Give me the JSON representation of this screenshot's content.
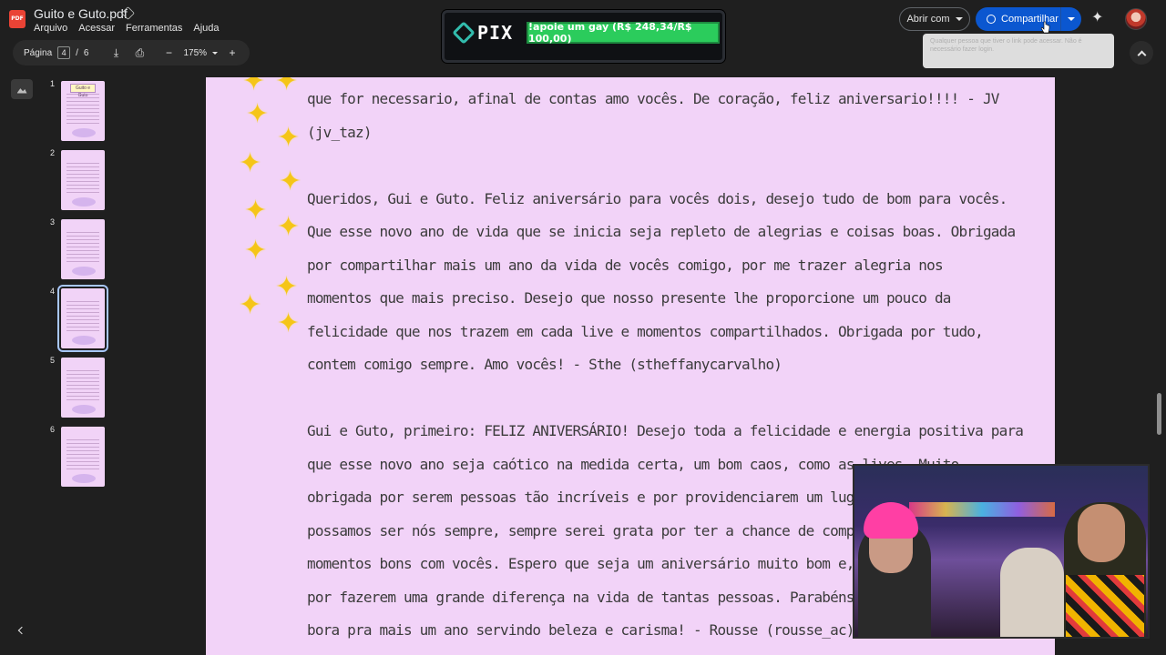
{
  "header": {
    "app_icon_label": "PDF",
    "title": "Guito e Guto.pdf",
    "menu": [
      "Arquivo",
      "Acessar",
      "Ferramentas",
      "Ajuda"
    ],
    "open_with": "Abrir com",
    "share": "Compartilhar",
    "tooltip": "Qualquer pessoa que tiver o link pode acessar. Não é necessário fazer login."
  },
  "overlay_pix": {
    "logo_text": "PIX",
    "goal_text": "!apoie um gay (R$ 248,34/R$ 100,00)"
  },
  "toolbar": {
    "page_label": "Página",
    "current_page": "4",
    "separator": "/",
    "total_pages": "6",
    "zoom": "175%"
  },
  "sidebar": {
    "pages": [
      {
        "num": "1",
        "header": "Guito e Guto"
      },
      {
        "num": "2"
      },
      {
        "num": "3"
      },
      {
        "num": "4",
        "active": true
      },
      {
        "num": "5"
      },
      {
        "num": "6"
      }
    ]
  },
  "document": {
    "paragraphs": [
      "que for necessario, afinal de contas amo vocês. De coração, feliz aniversario!!!! - JV\n(jv_taz)",
      "Queridos, Gui e Guto. Feliz aniversário para vocês dois, desejo tudo de bom para vocês.\nQue esse novo ano de vida que se inicia seja repleto de alegrias e coisas boas. Obrigada\npor compartilhar mais um ano da vida de vocês comigo, por me trazer alegria nos\nmomentos que mais preciso. Desejo que nosso presente lhe proporcione um pouco da\nfelicidade que nos trazem em cada live e momentos compartilhados. Obrigada por tudo,\ncontem comigo sempre. Amo vocês! - Sthe (stheffanycarvalho)",
      "Gui e Guto, primeiro: FELIZ ANIVERSÁRIO! Desejo toda a felicidade e energia positiva para\nque esse novo ano seja caótico na medida certa, um bom caos, como as lives. Muito\nobrigada por serem pessoas tão incríveis e por providenciarem um lugar s\npossamos ser nós sempre, sempre serei grata por ter a chance de compar\nmomentos bons com vocês. Espero que seja um aniversário muito bom e, de m\npor fazerem uma grande diferença na vida de tantas pessoas. Parabéns! A\nbora pra mais um ano servindo beleza e carisma! - Rousse (rousse_ac)"
    ]
  },
  "colors": {
    "page_bg": "#f2d3f8",
    "accent": "#0b57d0",
    "pix_green": "#2bcc5c",
    "sparkle": "#f5c518"
  }
}
